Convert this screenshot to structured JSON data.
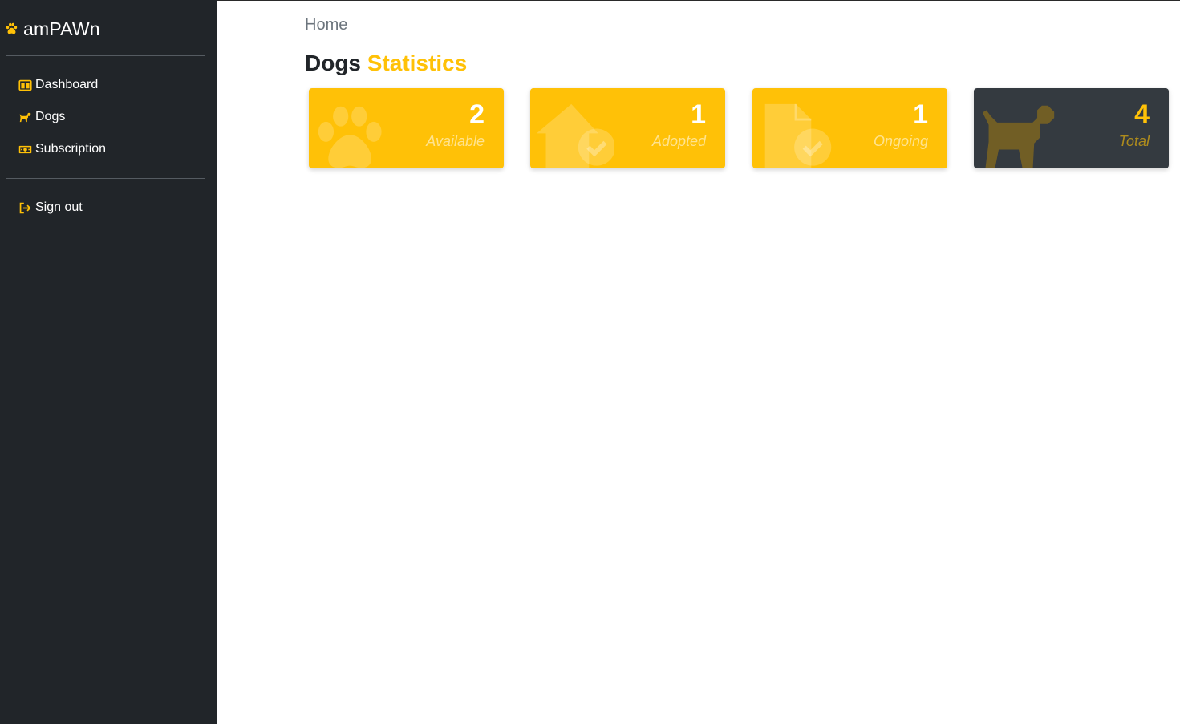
{
  "brand": {
    "name": "amPAWn",
    "icon": "paw-icon",
    "accent_color": "#ffc107"
  },
  "sidebar": {
    "items": [
      {
        "label": "Dashboard",
        "icon": "dashboard-icon"
      },
      {
        "label": "Dogs",
        "icon": "dog-icon"
      },
      {
        "label": "Subscription",
        "icon": "money-bill-icon"
      }
    ],
    "signout": {
      "label": "Sign out",
      "icon": "sign-out-icon"
    }
  },
  "breadcrumb": {
    "home": "Home"
  },
  "title": {
    "main": "Dogs",
    "accent": "Statistics"
  },
  "cards": [
    {
      "count": "2",
      "label": "Available",
      "icon": "paw-icon",
      "color": "#ffc107"
    },
    {
      "count": "1",
      "label": "Adopted",
      "icon": "house-check-icon",
      "color": "#ffc107"
    },
    {
      "count": "1",
      "label": "Ongoing",
      "icon": "file-check-icon",
      "color": "#ffc107"
    },
    {
      "count": "4",
      "label": "Total",
      "icon": "dog-icon",
      "color": "#343a40"
    }
  ]
}
